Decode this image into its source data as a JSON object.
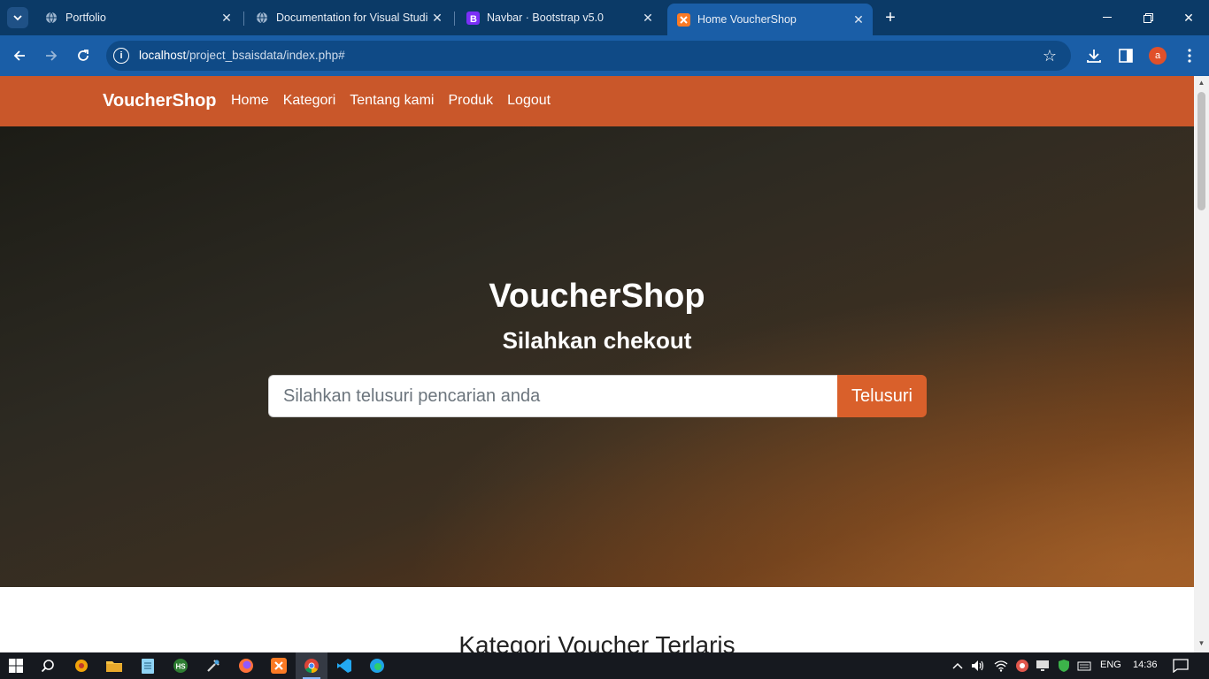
{
  "browser": {
    "tabs": [
      {
        "title": "Portfolio",
        "active": false
      },
      {
        "title": "Documentation for Visual Studio",
        "active": false
      },
      {
        "title": "Navbar · Bootstrap v5.0",
        "active": false
      },
      {
        "title": "Home VoucherShop",
        "active": true
      }
    ],
    "url_host": "localhost",
    "url_path": "/project_bsaisdata/index.php#",
    "profile_initial": "a"
  },
  "site": {
    "brand": "VoucherShop",
    "nav": [
      "Home",
      "Kategori",
      "Tentang kami",
      "Produk",
      "Logout"
    ],
    "hero_title": "VoucherShop",
    "hero_subtitle": "Silahkan chekout",
    "search_placeholder": "Silahkan telusuri pencarian anda",
    "search_button": "Telusuri",
    "section_title": "Kategori Voucher Terlaris"
  },
  "taskbar": {
    "language": "ENG",
    "time": "14:36"
  },
  "colors": {
    "navbar": "#c9572a",
    "button": "#d9602b",
    "browser_frame": "#1a5ea7"
  }
}
